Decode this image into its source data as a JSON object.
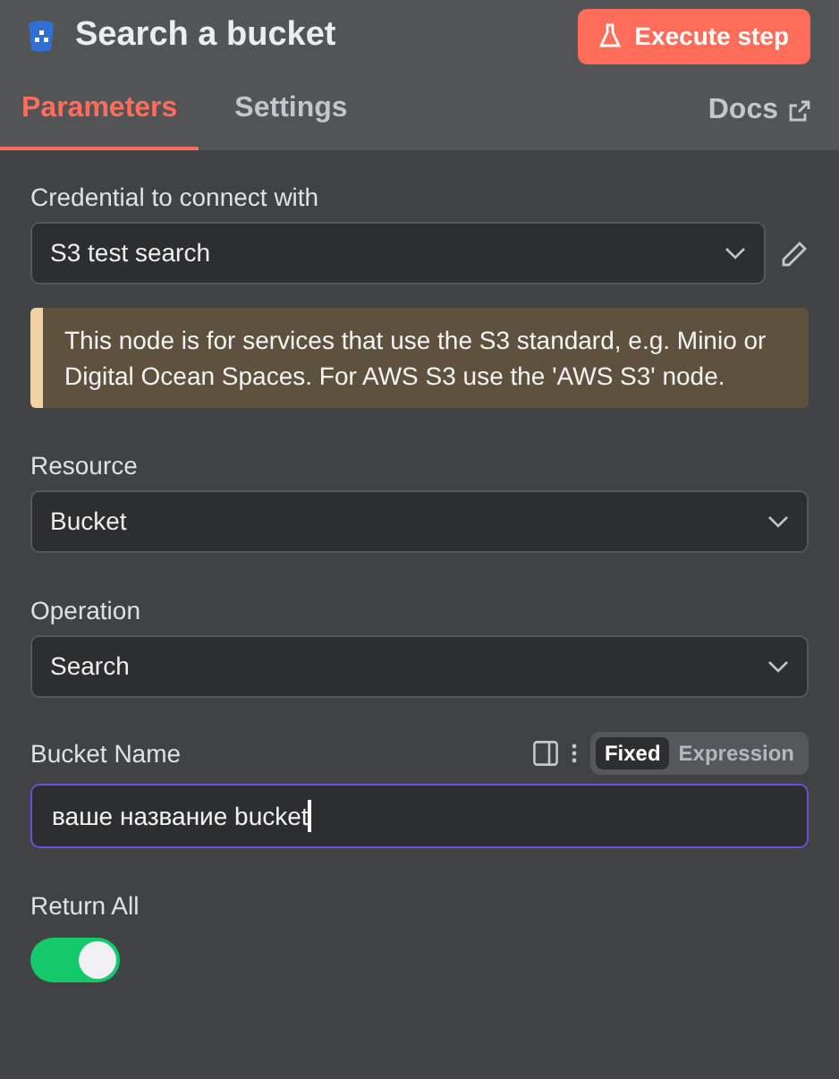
{
  "header": {
    "title": "Search a bucket",
    "execute_button": "Execute step"
  },
  "tabs": [
    {
      "label": "Parameters",
      "selected": true
    },
    {
      "label": "Settings",
      "selected": false
    }
  ],
  "docs_link": "Docs",
  "credential": {
    "label": "Credential to connect with",
    "value": "S3 test search"
  },
  "notice": "This node is for services that use the S3 standard, e.g. Minio or Digital Ocean Spaces. For AWS S3 use the 'AWS S3' node.",
  "resource": {
    "label": "Resource",
    "value": "Bucket"
  },
  "operation": {
    "label": "Operation",
    "value": "Search"
  },
  "bucket_name": {
    "label": "Bucket Name",
    "value": "ваше название bucket",
    "modes": [
      {
        "label": "Fixed",
        "selected": true
      },
      {
        "label": "Expression",
        "selected": false
      }
    ]
  },
  "return_all": {
    "label": "Return All",
    "on": true
  }
}
